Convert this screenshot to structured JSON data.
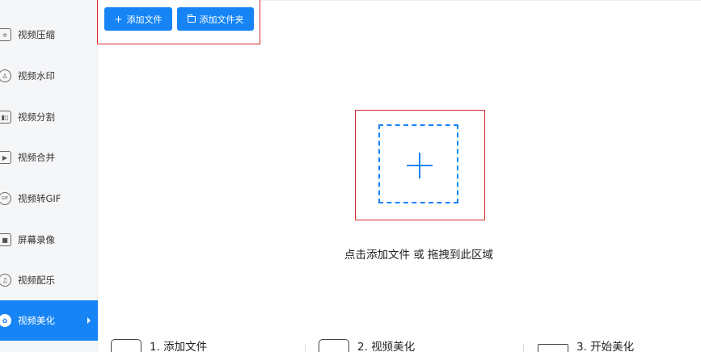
{
  "sidebar": {
    "items": [
      {
        "label": "视频压缩",
        "icon": "compress-icon",
        "glyph": "≑"
      },
      {
        "label": "视频水印",
        "icon": "watermark-icon",
        "glyph": "♙"
      },
      {
        "label": "视频分割",
        "icon": "split-icon",
        "glyph": "▮▯"
      },
      {
        "label": "视频合并",
        "icon": "merge-icon",
        "glyph": "▶"
      },
      {
        "label": "视频转GIF",
        "icon": "gif-icon",
        "glyph": "GIF"
      },
      {
        "label": "屏幕录像",
        "icon": "screen-record-icon",
        "glyph": "■"
      },
      {
        "label": "视频配乐",
        "icon": "music-icon",
        "glyph": "♫"
      },
      {
        "label": "视频美化",
        "icon": "beautify-icon",
        "glyph": "✿",
        "active": true
      }
    ]
  },
  "toolbar": {
    "add_file_label": "添加文件",
    "add_file_icon": "+",
    "add_folder_label": "添加文件夹"
  },
  "dropzone": {
    "hint": "点击添加文件 或 拖拽到此区域"
  },
  "steps": [
    {
      "label": "1. 添加文件",
      "icon": "add-file-step-icon"
    },
    {
      "label": "2. 视频美化",
      "icon": "beautify-step-icon"
    },
    {
      "label": "3. 开始美化",
      "icon": "start-step-icon"
    }
  ],
  "colors": {
    "accent": "#1684f5",
    "highlight_frame": "#d9262b",
    "sidebar_bg": "#f5f6f8"
  }
}
